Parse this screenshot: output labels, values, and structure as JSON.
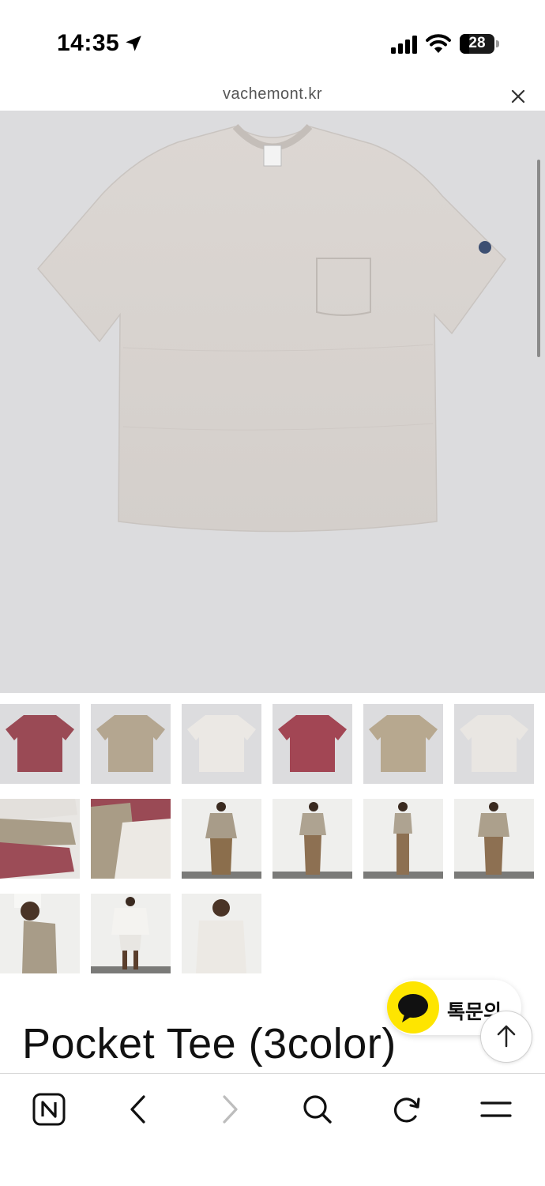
{
  "status_bar": {
    "time": "14:35",
    "battery_percent": "28",
    "battery_level": 0.28
  },
  "browser": {
    "url": "vachemont.kr"
  },
  "product": {
    "title": "Pocket Tee (3color)"
  },
  "thumbnails": [
    {
      "row": 1,
      "desc": "maroon tee flat"
    },
    {
      "row": 1,
      "desc": "beige tee flat"
    },
    {
      "row": 1,
      "desc": "white tee flat"
    },
    {
      "row": 1,
      "desc": "maroon tee flat"
    },
    {
      "row": 1,
      "desc": "beige tee flat"
    },
    {
      "row": 1,
      "desc": "white tee flat"
    },
    {
      "row": 2,
      "desc": "stacked tees"
    },
    {
      "row": 2,
      "desc": "layered tees"
    },
    {
      "row": 2,
      "desc": "model front"
    },
    {
      "row": 2,
      "desc": "model side"
    },
    {
      "row": 2,
      "desc": "model side"
    },
    {
      "row": 2,
      "desc": "model back"
    },
    {
      "row": 3,
      "desc": "model close"
    },
    {
      "row": 3,
      "desc": "model white set"
    },
    {
      "row": 3,
      "desc": "model white tee"
    }
  ],
  "chat_widget": {
    "label": "톡문의"
  },
  "colors": {
    "hero_bg": "#dcdcde",
    "tee_grey": "#d9d4d0",
    "maroon": "#9a4a55",
    "beige": "#b4a690",
    "kakao_yellow": "#fee500"
  },
  "icons": {
    "back": "chevron-left-icon",
    "forward": "chevron-right-icon",
    "search": "search-icon",
    "refresh": "refresh-icon",
    "menu": "menu-icon",
    "home": "naver-n-icon"
  }
}
